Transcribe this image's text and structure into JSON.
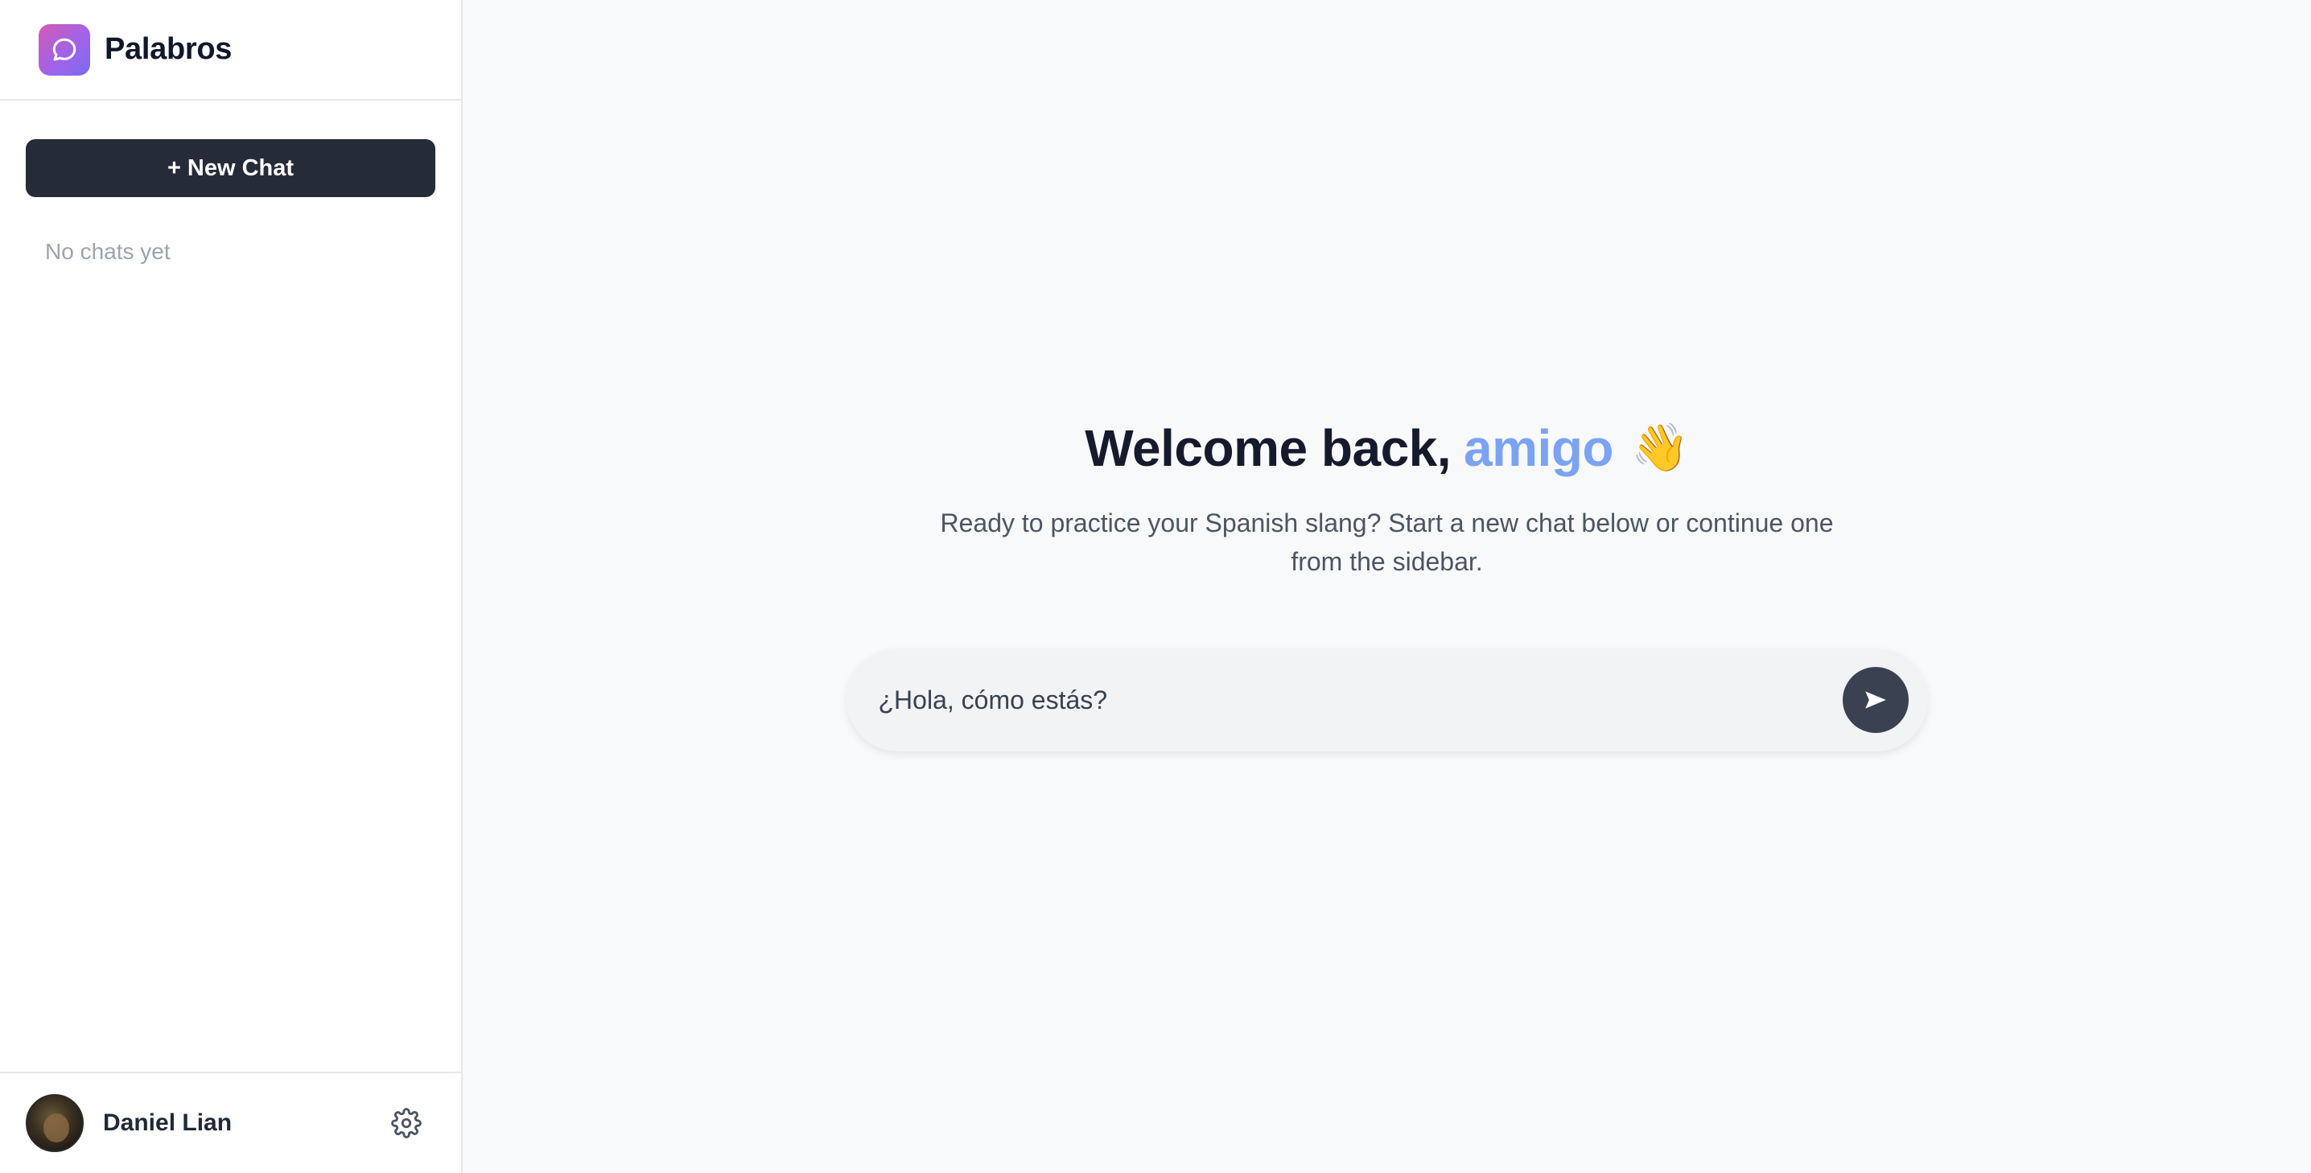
{
  "brand": {
    "name": "Palabros",
    "logo_icon": "chat-bubble-icon"
  },
  "sidebar": {
    "new_chat_label": "+ New Chat",
    "empty_text": "No chats yet"
  },
  "user": {
    "name": "Daniel Lian",
    "settings_icon": "gear-icon"
  },
  "main": {
    "welcome_prefix": "Welcome back,",
    "welcome_accent": "amigo",
    "welcome_emoji": "👋",
    "subtitle": "Ready to practice your Spanish slang? Start a new chat below or continue one from the sidebar.",
    "input_placeholder": "¿Hola, cómo estás?",
    "send_icon": "send-arrow-icon"
  },
  "colors": {
    "brand_gradient_start": "#d45ab4",
    "brand_gradient_end": "#7b6cf0",
    "accent": "#7ba3f2",
    "button_dark": "#252b37",
    "send_button": "#3a4150"
  }
}
